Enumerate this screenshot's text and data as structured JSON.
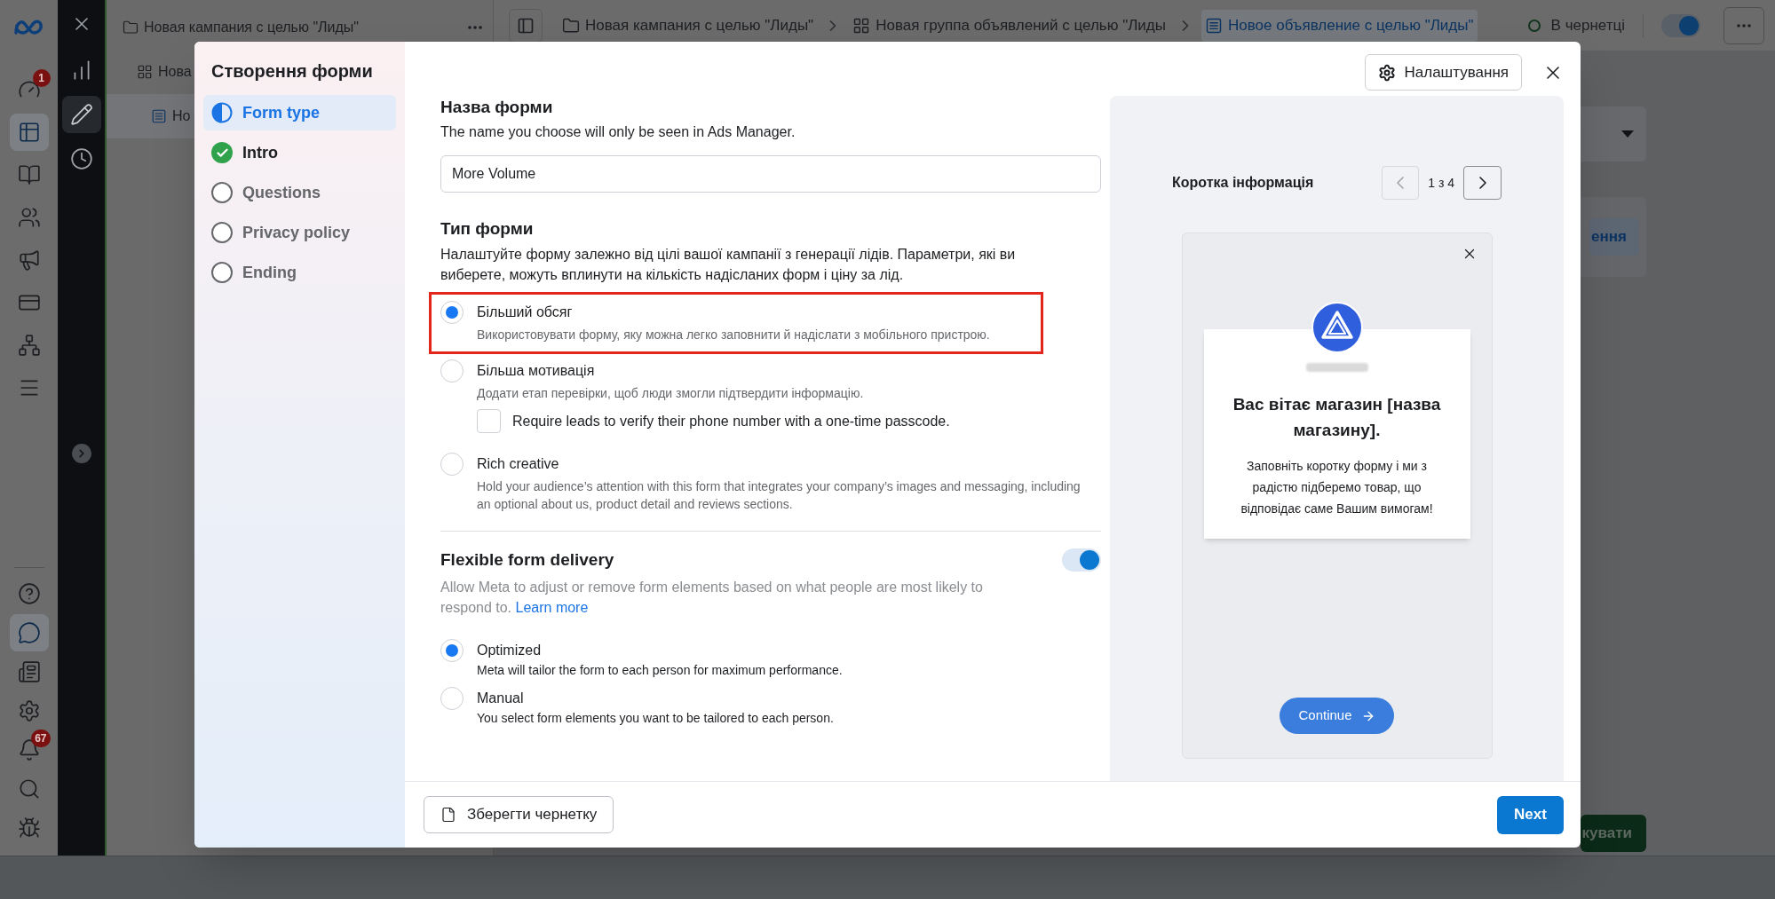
{
  "app_rail": {
    "top_items": [
      {
        "kind": "gauge",
        "badge": "1",
        "selected": false
      },
      {
        "kind": "table",
        "selected": true
      },
      {
        "kind": "pages",
        "selected": false
      },
      {
        "kind": "audience",
        "selected": false
      },
      {
        "kind": "megaphone",
        "selected": false
      },
      {
        "kind": "billing",
        "selected": false
      },
      {
        "kind": "network",
        "selected": false
      },
      {
        "kind": "menu",
        "selected": false
      }
    ],
    "bottom_items": [
      {
        "kind": "help",
        "selected": false
      },
      {
        "kind": "chat",
        "selected": true
      },
      {
        "kind": "news",
        "selected": false
      },
      {
        "kind": "settings",
        "selected": false
      },
      {
        "kind": "bell",
        "badge": "67",
        "selected": false
      },
      {
        "kind": "search",
        "selected": false
      },
      {
        "kind": "bug",
        "selected": false
      }
    ]
  },
  "tool_rail": {
    "items": [
      {
        "kind": "chart",
        "selected": false
      },
      {
        "kind": "edit",
        "selected": true
      },
      {
        "kind": "history",
        "selected": false
      }
    ]
  },
  "campaign_tree": {
    "items": [
      {
        "kind": "campaign",
        "label": "Новая кампания с целью \"Лиды\"",
        "selected": false,
        "children": [
          {
            "kind": "ad_set",
            "label": "Нова",
            "selected": false,
            "children": [
              {
                "kind": "ad",
                "label": "Но",
                "selected": true
              }
            ]
          }
        ]
      }
    ]
  },
  "top_bar": {
    "breadcrumbs": [
      {
        "kind": "campaign",
        "label": "Новая кампания с целью \"Лиды\"",
        "selected": false
      },
      {
        "kind": "ad_set",
        "label": "Новая группа объявлений с целью \"Лиды",
        "selected": false
      },
      {
        "kind": "ad",
        "label": "Новое объявление с целью \"Лиды\"",
        "selected": true
      }
    ],
    "status": "В чернетці",
    "toggle_on": true
  },
  "background": {
    "buttons": [
      {
        "kind": "secondary",
        "label": "ення"
      },
      {
        "kind": "primary",
        "label": "кувати"
      }
    ]
  },
  "modal": {
    "title": "Створення форми",
    "steps": [
      {
        "label": "Form type",
        "kind": "current",
        "selected": true
      },
      {
        "label": "Intro",
        "kind": "done",
        "selected": false
      },
      {
        "label": "Questions",
        "kind": "todo",
        "selected": false
      },
      {
        "label": "Privacy policy",
        "kind": "todo",
        "selected": false
      },
      {
        "label": "Ending",
        "kind": "todo",
        "selected": false
      }
    ],
    "settings_button": "Налаштування",
    "form": {
      "name_heading": "Назва форми",
      "name_hint": "The name you choose will only be seen in Ads Manager.",
      "name_value": "More Volume",
      "type_heading": "Тип форми",
      "type_description": "Налаштуйте форму залежно від цілі вашої кампанії з генерації лідів. Параметри, які ви виберете, можуть вплинути на кількість надісланих форм і ціну за лід.",
      "types": [
        {
          "label": "Більший обсяг",
          "description": "Використовувати форму, яку можна легко заповнити й надіслати з мобільного пристрою.",
          "selected": true,
          "highlighted": true
        },
        {
          "label": "Більша мотивація",
          "description": "Додати етап перевірки, щоб люди змогли підтвердити інформацію.",
          "selected": false,
          "highlighted": false,
          "option": {
            "label": "Require leads to verify their phone number with a one-time passcode.",
            "checked": false
          }
        },
        {
          "label": "Rich creative",
          "description": "Hold your audience’s attention with this form that integrates your company’s images and messaging, including an optional about us, product detail and reviews sections.",
          "selected": false,
          "highlighted": false
        }
      ],
      "delivery": {
        "heading": "Flexible form delivery",
        "on": true,
        "description": "Allow Meta to adjust or remove form elements based on what people are most likely to respond to.",
        "link": "Learn more",
        "modes": [
          {
            "label": "Optimized",
            "description": "Meta will tailor the form to each person for maximum performance.",
            "selected": true
          },
          {
            "label": "Manual",
            "description": "You select form elements you want to be tailored to each person.",
            "selected": false
          }
        ]
      }
    },
    "preview": {
      "title": "Коротка інформація",
      "pager": {
        "label": "1 з 4",
        "previous_disabled": true,
        "next_disabled": false
      },
      "card": {
        "heading": "Вас вітає магазин [назва магазину].",
        "body": "Заповніть коротку форму і ми з радістю підберемо товар, що відповідає саме Вашим вимогам!",
        "button": "Continue"
      }
    },
    "footer": {
      "save_draft": "Зберегти чернетку",
      "next": "Next"
    }
  }
}
